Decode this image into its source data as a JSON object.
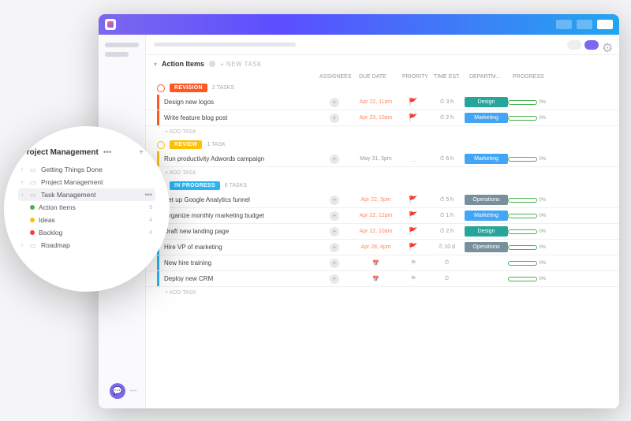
{
  "section": {
    "title": "Action Items",
    "new_task": "+ NEW TASK"
  },
  "columns": {
    "assignees": "ASSIGNEES",
    "due": "DUE DATE",
    "priority": "PRIORITY",
    "est": "TIME EST.",
    "dept": "DEPARTM...",
    "progress": "PROGRESS"
  },
  "add_task": "+ ADD TASK",
  "groups": [
    {
      "name": "REVISION",
      "color": "#ff5722",
      "count": "2 TASKS",
      "tasks": [
        {
          "name": "Design new logos",
          "due": "Apr 22, 11am",
          "prio": "🚩",
          "prio_color": "#f44336",
          "est": "3 h",
          "dept": "Design",
          "dept_color": "#26a69a",
          "prog": "0%"
        },
        {
          "name": "Write feature blog post",
          "due": "Apr 23, 10am",
          "prio": "🚩",
          "prio_color": "#ff9800",
          "est": "2 h",
          "dept": "Marketing",
          "dept_color": "#42a5f5",
          "prog": "0%"
        }
      ]
    },
    {
      "name": "REVIEW",
      "color": "#ffc107",
      "count": "1 TASK",
      "tasks": [
        {
          "name": "Run productivity Adwords campaign",
          "due": "May 31, 5pm",
          "due_gray": true,
          "prio": "…",
          "prio_color": "#ccc",
          "est": "6 h",
          "dept": "Marketing",
          "dept_color": "#42a5f5",
          "prog": "0%"
        }
      ]
    },
    {
      "name": "IN PROGRESS",
      "color": "#29b6f6",
      "count": "6 TASKS",
      "tasks": [
        {
          "name": "Set up Google Analytics funnel",
          "due": "Apr 22, 3pm",
          "prio": "🚩",
          "prio_color": "#f44336",
          "est": "5 h",
          "dept": "Operations",
          "dept_color": "#78909c",
          "prog": "0%"
        },
        {
          "name": "Organize monthly marketing budget",
          "due": "Apr 22, 12pm",
          "prio": "🚩",
          "prio_color": "#ff9800",
          "est": "1 h",
          "dept": "Marketing",
          "dept_color": "#42a5f5",
          "prog": "0%"
        },
        {
          "name": "Draft new landing page",
          "due": "Apr 22, 10am",
          "prio": "🚩",
          "prio_color": "#ff9800",
          "est": "2 h",
          "dept": "Design",
          "dept_color": "#26a69a",
          "prog": "0%"
        },
        {
          "name": "Hire VP of marketing",
          "due": "Apr 28, 4pm",
          "prio": "🚩",
          "prio_color": "#9e9e9e",
          "est": "10 d",
          "dept": "Operations",
          "dept_color": "#78909c",
          "prog": "0%"
        },
        {
          "name": "New hire training",
          "due": "",
          "prio": "",
          "est": "",
          "dept": "",
          "prog": "0%",
          "empty": true
        },
        {
          "name": "Deploy new CRM",
          "due": "",
          "prio": "",
          "est": "",
          "dept": "",
          "prog": "0%",
          "empty": true
        }
      ]
    }
  ],
  "sidebar": {
    "title": "Project Management",
    "items": [
      {
        "label": "Getting Things Done",
        "type": "folder"
      },
      {
        "label": "Project Management",
        "type": "folder"
      },
      {
        "label": "Task Management",
        "type": "folder",
        "selected": true
      },
      {
        "label": "Action Items",
        "type": "list",
        "dot": "#4caf50",
        "count": "9"
      },
      {
        "label": "Ideas",
        "type": "list",
        "dot": "#ffc107",
        "count": "4"
      },
      {
        "label": "Backlog",
        "type": "list",
        "dot": "#f44336",
        "count": "4"
      },
      {
        "label": "Roadmap",
        "type": "folder"
      }
    ]
  }
}
